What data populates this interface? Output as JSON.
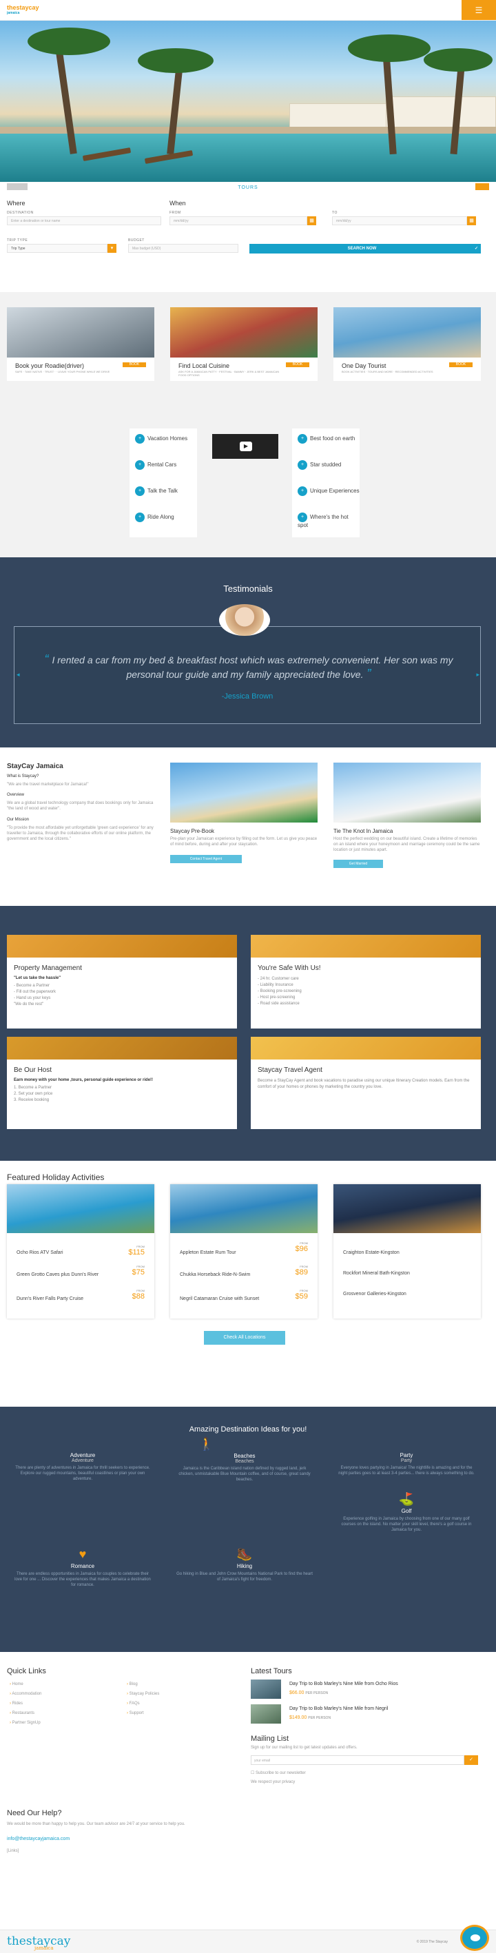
{
  "header": {
    "logo_text": "thestaycay",
    "logo_sub": "jamaica",
    "menu_icon": "hamburger-icon"
  },
  "hero": {
    "tab_label": "TOURS"
  },
  "search": {
    "where": "Where",
    "destination_label": "DESTINATION",
    "destination_placeholder": "Enter a destination or tour name",
    "when": "When",
    "from_label": "FROM",
    "from_placeholder": "mm/dd/yy",
    "to_label": "TO",
    "to_placeholder": "mm/dd/yy",
    "trip_type_label": "TRIP TYPE",
    "trip_type_value": "Trip Type",
    "budget_label": "BUDGET",
    "budget_placeholder": "Max budget (USD)",
    "search_button": "SEARCH NOW"
  },
  "cards": [
    {
      "title": "Book your Roadie(driver)",
      "desc": "SAFE · TAKE NATIVE · TRUST · · LEAVE YOUR PHONE WHILE WE DRIVE",
      "tag": "BOOK"
    },
    {
      "title": "Find Local Cuisine",
      "desc": "ASK FOR A JAMAICAN PATTY · FESTIVAL · BAMMY · JERK & BEST JAMAICAN FOOD OPTIONS",
      "tag": "BOOK"
    },
    {
      "title": "One Day Tourist",
      "desc": "BOOK ACTIVITIES · TOURS AND MORE · RECOMMENDED ACTIVITIES",
      "tag": "BOOK"
    }
  ],
  "features_left": [
    "Vacation Homes",
    "Rental Cars",
    "Talk the Talk",
    "Ride Along"
  ],
  "features_right": [
    "Best food on earth",
    "Star studded",
    "Unique Experiences",
    "Where's the hot spot"
  ],
  "testimonials": {
    "title": "Testimonials",
    "quote": "I rented a car from my bed & breakfast host which was extremely convenient. Her son was my personal tour guide and my family appreciated the love.",
    "author": "-Jessica Brown"
  },
  "about": {
    "title": "StayCay Jamaica",
    "q1": "What is Staycay?",
    "a1": "\"We are the travel marketplace for Jamaica!\"",
    "q2": "Overview",
    "a2": "We are a global travel technology company that does bookings only for Jamaica \"the land of wood and water\".",
    "q3": "Our Mission",
    "a3": "\"To provide the most affordable yet unforgettable 'green card experience' for any traveller to Jamaica, through the collaborative efforts of our online platform, the government and the local citizens.\""
  },
  "prebook": {
    "title": "Staycay Pre-Book",
    "text": "Pre-plan your Jamaican experience by filling out the form. Let us give you peace of mind before, during and after your staycation.",
    "button": "Contact Travel Agent"
  },
  "wedding": {
    "title": "Tie The Knot In Jamaica",
    "text": "Host the perfect wedding on our beautiful island. Create a lifetime of memories on an island where your honeymoon and marriage ceremony could be the same location or just minutes apart.",
    "button": "Get Married"
  },
  "boxes": [
    {
      "title": "Property Management",
      "sub": "\"Let us take the hassle\"",
      "lines": [
        "- Become a Partner",
        "- Fill out the paperwork",
        "- Hand us your keys",
        "\"We do the rest\""
      ]
    },
    {
      "title": "You're Safe With Us!",
      "sub": "",
      "lines": [
        "- 24 hr. Customer care",
        "- Liability Insurance",
        "- Booking pre-screening",
        "- Host pre-screening",
        "- Road side assistance"
      ]
    },
    {
      "title": "Be Our Host",
      "sub": "Earn money with your home ,tours, personal guide experience or ride!!",
      "lines": [
        "1. Become a Partner",
        "2. Set your own price",
        "3. Receive booking"
      ]
    },
    {
      "title": "Staycay Travel Agent",
      "sub": "",
      "lines": [
        "Become a StayCay Agent and book vacations to paradise using our unique Itinerary Creation models. Earn from the comfort of your homes or phones by marketing the country you love."
      ]
    }
  ],
  "featured": {
    "title": "Featured Holiday Activities",
    "cols": [
      [
        {
          "name": "Ocho Rios ATV Safari",
          "price": "$115",
          "from": "FROM"
        },
        {
          "name": "Green Grotto Caves plus Dunn's River",
          "price": "$75",
          "from": "FROM"
        },
        {
          "name": "Dunn's River Falls Party Cruise",
          "price": "$88",
          "from": "FROM"
        }
      ],
      [
        {
          "name": "Appleton Estate Rum Tour",
          "price": "$96",
          "from": "FROM"
        },
        {
          "name": "Chukka Horseback Ride-N-Swim",
          "price": "$89",
          "from": "FROM"
        },
        {
          "name": "Negril Catamaran Cruise with Sunset",
          "price": "$59",
          "from": "FROM"
        }
      ],
      [
        {
          "name": "Craighton Estate-Kingston",
          "price": "",
          "from": ""
        },
        {
          "name": "Rockfort Mineral Bath-Kingston",
          "price": "",
          "from": ""
        },
        {
          "name": "Grosvenor Galleries-Kingston",
          "price": "",
          "from": ""
        }
      ]
    ],
    "button": "Check All Locations"
  },
  "ideas": {
    "title": "Amazing Destination Ideas for you!",
    "items": [
      {
        "t": "Adventure",
        "t2": "Adventure",
        "p": "There are plenty of adventures in Jamaica for thrill seekers to experience. Explore our rugged mountains, beautiful coastlines or plan your own adventure.",
        "icon": "hiker-icon"
      },
      {
        "t": "Beaches",
        "t2": "Beaches",
        "p": "Jamaica is the Caribbean island nation defined by rugged land, jerk chicken, unmistakable Blue Mountain coffee, and of course, great sandy beaches.",
        "icon": "hiker-icon"
      },
      {
        "t": "Party",
        "t2": "Party",
        "p": "Everyone loves partying in Jamaica! The nightlife is amazing and for the night parties goes to at least 3-4 parties... there is always something to do.",
        "icon": "party-icon"
      },
      {
        "t": "Golf",
        "t2": "",
        "p": "Experience golfing in Jamaica by choosing from one of our many golf courses on the island. No matter your skill level, there's a golf course in Jamaica for you.",
        "icon": "golf-icon"
      },
      {
        "t": "Romance",
        "t2": "",
        "p": "There are endless opportunities in Jamaica for couples to celebrate their love for one ... Discover the experiences that makes Jamaica a destination for romance.",
        "icon": "heart-icon"
      },
      {
        "t": "Hiking",
        "t2": "",
        "p": "Go hiking in Blue and John Crow Mountains National Park to find the heart of Jamaica's fight for freedom.",
        "icon": "hiking-icon"
      }
    ]
  },
  "footer": {
    "quick_title": "Quick Links",
    "links_a": [
      "Home",
      "Accommodation",
      "Rides",
      "Restaurants",
      "Partner SignUp"
    ],
    "links_b": [
      "Blog",
      "Staycay Policies",
      "FAQs",
      "Support"
    ],
    "tours_title": "Latest Tours",
    "tours": [
      {
        "t": "Day Trip to Bob Marley's Nine Mile from Ocho Rios",
        "p": "$66.00",
        "u": "PER PERSON"
      },
      {
        "t": "Day Trip to Bob Marley's Nine Mile from Negril",
        "p": "$149.00",
        "u": "PER PERSON"
      }
    ],
    "mail_title": "Mailing List",
    "mail_text": "Sign up for our mailing list to get latest updates and offers.",
    "mail_placeholder": "your email",
    "mail_check": "Subscribe to our newsletter",
    "mail_privacy": "We respect your privacy",
    "help_title": "Need Our Help?",
    "help_text": "We would be more than happy to help you. Our team advisor are 24/7 at your service to help you.",
    "help_email": "info@thestaycayjamaica.com",
    "help_links": "[Links]",
    "copyright": "© 2019 The Staycay"
  }
}
